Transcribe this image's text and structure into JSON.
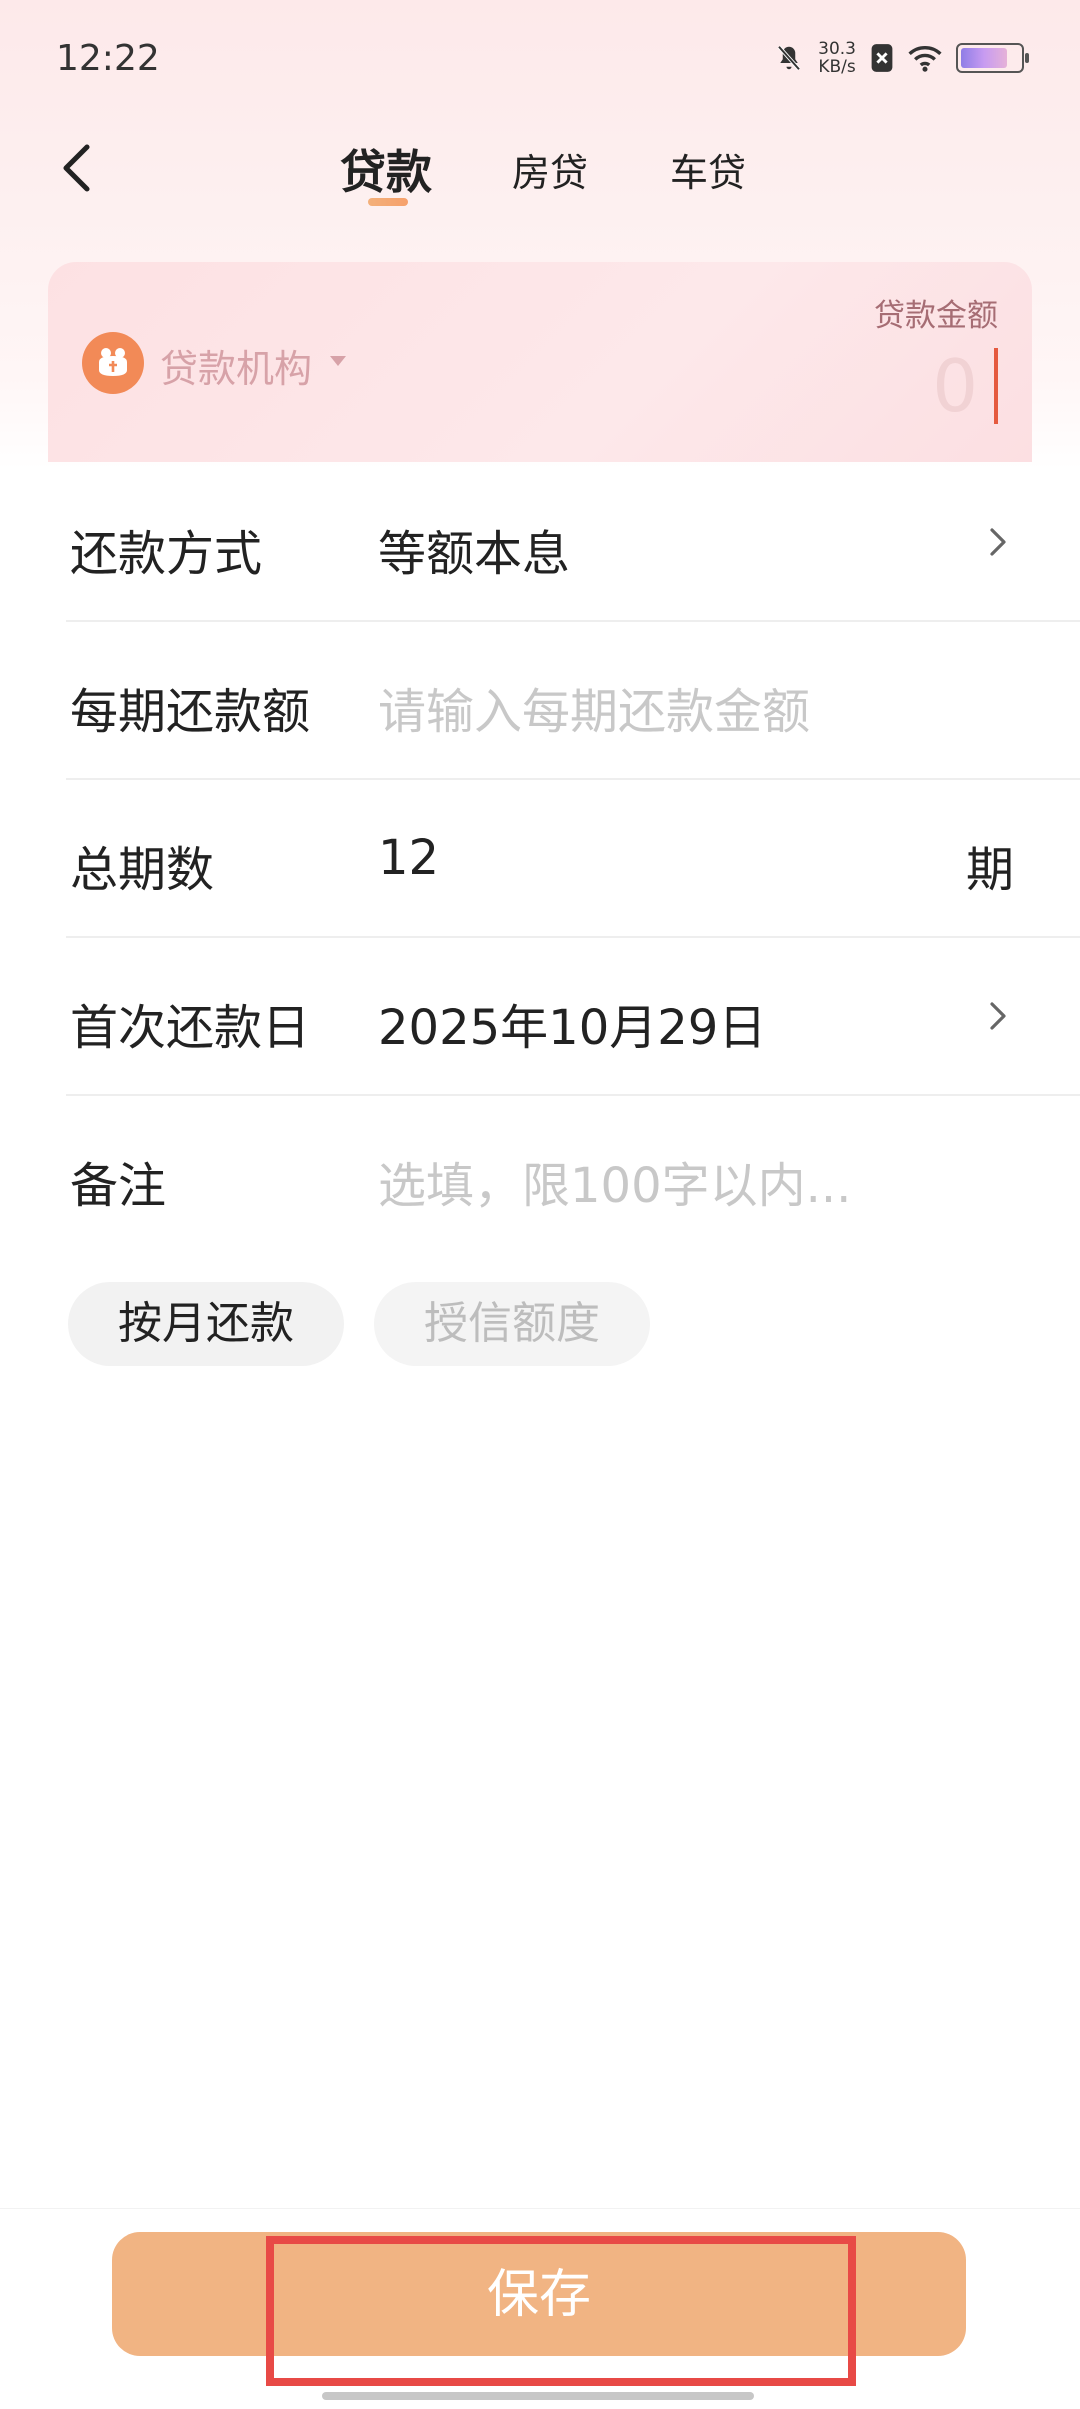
{
  "status": {
    "time": "12:22",
    "net_speed_value": "30.3",
    "net_speed_unit": "KB/s",
    "battery_percent": 80
  },
  "tabs": [
    {
      "label": "贷款",
      "active": true
    },
    {
      "label": "房贷",
      "active": false
    },
    {
      "label": "车贷",
      "active": false
    }
  ],
  "card": {
    "institution_label": "贷款机构",
    "amount_label": "贷款金额",
    "amount_value": "0"
  },
  "form": {
    "repayment_method": {
      "label": "还款方式",
      "value": "等额本息"
    },
    "per_period_amount": {
      "label": "每期还款额",
      "placeholder": "请输入每期还款金额"
    },
    "total_periods": {
      "label": "总期数",
      "value": "12",
      "unit": "期"
    },
    "first_repayment_date": {
      "label": "首次还款日",
      "value": "2025年10月29日"
    },
    "note": {
      "label": "备注",
      "placeholder": "选填，限100字以内..."
    }
  },
  "chips": [
    {
      "label": "按月还款",
      "selected": true
    },
    {
      "label": "授信额度",
      "selected": false
    }
  ],
  "save_label": "保存",
  "colors": {
    "accent": "#f1b483",
    "highlight": "#e84a46",
    "institution_icon": "#f28a57",
    "caret": "#e55a3f"
  },
  "icons": {
    "back": "back-arrow-icon",
    "chevron": "chevron-right-icon",
    "institution": "money-bag-icon"
  }
}
